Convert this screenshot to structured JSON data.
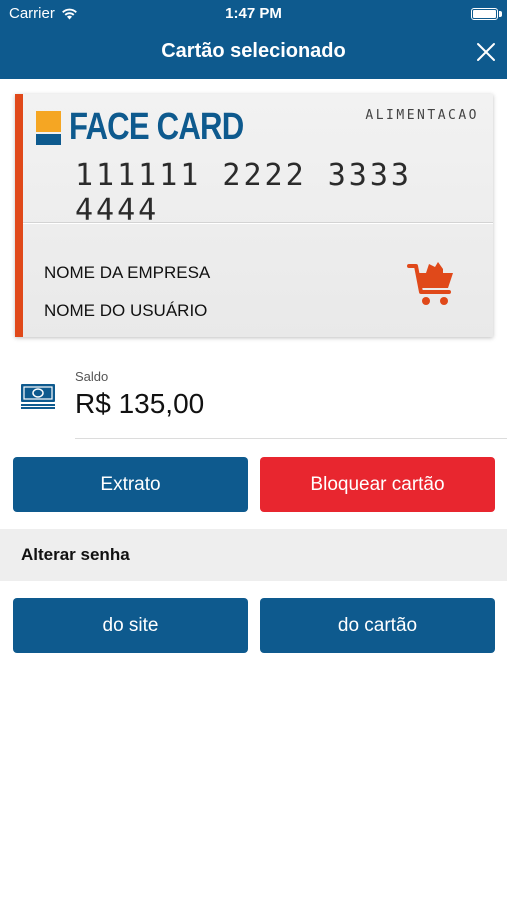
{
  "status_bar": {
    "carrier": "Carrier",
    "time": "1:47 PM",
    "wifi_icon": "wifi-icon",
    "battery_icon": "battery-icon",
    "battery_level": 1.0
  },
  "nav": {
    "title": "Cartão selecionado",
    "close_icon": "close-icon"
  },
  "card": {
    "brand": "FACE CARD",
    "type": "ALIMENTACAO",
    "number": "111111 2222 3333 4444",
    "company": "NOME DA EMPRESA",
    "user": "NOME DO USUÁRIO",
    "icon": "shopping-cart-icon",
    "accent_color": "#e0491a"
  },
  "balance": {
    "label": "Saldo",
    "value": "R$ 135,00",
    "icon": "money-icon"
  },
  "actions": {
    "statement_label": "Extrato",
    "block_label": "Bloquear cartão"
  },
  "password": {
    "section_title": "Alterar senha",
    "site_label": "do site",
    "card_label": "do cartão"
  },
  "colors": {
    "primary": "#0e5a8e",
    "danger": "#e8262f",
    "logo_yellow": "#f5a623"
  }
}
